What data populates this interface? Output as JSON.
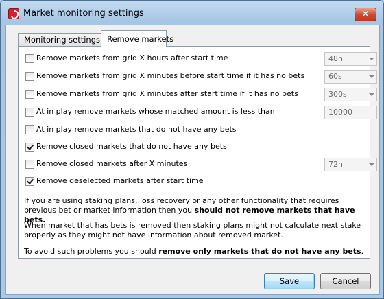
{
  "window": {
    "title": "Market monitoring settings",
    "close_glyph": "✕"
  },
  "tabs": [
    {
      "label": "Monitoring settings"
    },
    {
      "label": "Remove markets"
    }
  ],
  "options": [
    {
      "label": "Remove markets from grid X hours after start time",
      "checked": false,
      "control": "combo",
      "value": "48h"
    },
    {
      "label": "Remove markets from grid X minutes before start time if it has no bets",
      "checked": false,
      "control": "combo",
      "value": "60s"
    },
    {
      "label": "Remove markets from grid X minutes after start time if it has no bets",
      "checked": false,
      "control": "combo",
      "value": "300s"
    },
    {
      "label": "At in play remove markets whose matched amount is less than",
      "checked": false,
      "control": "text",
      "value": "10000"
    },
    {
      "label": "At in play remove markets that do not have any bets",
      "checked": false
    },
    {
      "label": "Remove closed markets that do not have any bets",
      "checked": true
    },
    {
      "label": "Remove closed markets after X minutes",
      "checked": false,
      "control": "combo",
      "value": "72h"
    },
    {
      "label": "Remove deselected markets after start time",
      "checked": true
    }
  ],
  "info": {
    "p1_start": "If you are using staking plans, loss recovery or any other functionality that requires previous bet or market information then you ",
    "p1_bold": "should not remove markets that have bets.",
    "p2": "When market that has bets is removed then staking plans might not calculate next stake properly as they might not have information about removed market.",
    "p3_start": "To avoid such problems you should ",
    "p3_bold": "remove only markets that do not have any bets",
    "p3_end": "."
  },
  "buttons": {
    "save": "Save",
    "cancel": "Cancel"
  },
  "icons": {
    "app": "app-logo-icon",
    "close": "close-icon",
    "dropdown": "chevron-down-icon",
    "check": "checkmark-icon"
  }
}
